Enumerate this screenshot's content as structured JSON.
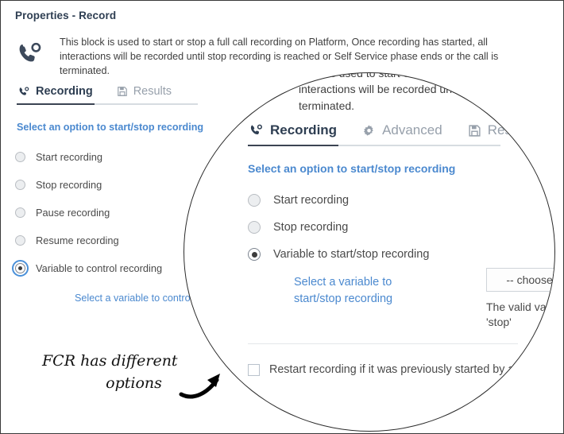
{
  "window": {
    "title": "Properties - Record"
  },
  "description": {
    "icon": "phone-record-icon",
    "text": "This block is used to start or stop a full call recording on Platform, Once recording has started, all interactions will be recorded until stop recording is reached or Self Service phase ends or the call is terminated."
  },
  "tabs": [
    {
      "label": "Recording",
      "icon": "phone-record-icon",
      "active": true
    },
    {
      "label": "Results",
      "icon": "floppy-disk-icon",
      "active": false
    }
  ],
  "section": {
    "label": "Select an option to start/stop recording"
  },
  "radio_options": [
    {
      "label": "Start recording",
      "checked": false
    },
    {
      "label": "Stop recording",
      "checked": false
    },
    {
      "label": "Pause recording",
      "checked": false
    },
    {
      "label": "Resume recording",
      "checked": false
    },
    {
      "label": "Variable to control recording",
      "checked": true
    }
  ],
  "variable_link": "Select a variable to control recording",
  "annotation": {
    "line1": "FCR has different",
    "line2": "options",
    "arrow": "curved-arrow-icon"
  },
  "magnifier": {
    "clipped_description": "block is used to start o\ninteractions will be recorded until s\nterminated.",
    "tabs": [
      {
        "label": "Recording",
        "icon": "phone-record-icon",
        "active": true
      },
      {
        "label": "Advanced",
        "icon": "gear-icon",
        "active": false
      },
      {
        "label": "Results",
        "icon": "floppy-disk-icon",
        "active": false
      }
    ],
    "section_label": "Select an option to start/stop recording",
    "radio_options": [
      {
        "label": "Start recording",
        "checked": false
      },
      {
        "label": "Stop recording",
        "checked": false
      },
      {
        "label": "Variable to start/stop recording",
        "checked": true
      }
    ],
    "variable_link": "Select a variable to start/stop recording",
    "select_value": "-- choose v",
    "hint_text": "The valid va\n'stop'",
    "checkbox": {
      "label": "Restart recording if it was previously started by another R",
      "checked": false
    }
  },
  "colors": {
    "accent_link": "#4b89cf",
    "title": "#2e3e52",
    "body_text": "#4a4a4a",
    "tab_inactive": "#97a0ab",
    "border": "#3a3a3a"
  }
}
